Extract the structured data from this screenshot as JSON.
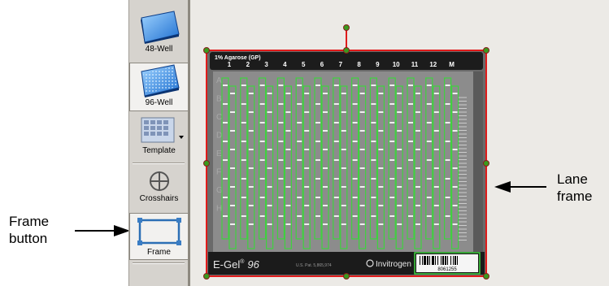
{
  "toolbar": {
    "buttons": [
      {
        "label": "48-Well",
        "icon": "plate-48-icon"
      },
      {
        "label": "96-Well",
        "icon": "plate-96-icon",
        "selected": true
      },
      {
        "label": "Template",
        "icon": "template-icon"
      },
      {
        "label": "Crosshairs",
        "icon": "crosshairs-icon"
      },
      {
        "label": "Frame",
        "icon": "frame-icon",
        "selected": true
      }
    ]
  },
  "gel": {
    "header_label": "1% Agarose (GP)",
    "lane_numbers": [
      "1",
      "2",
      "3",
      "4",
      "5",
      "6",
      "7",
      "8",
      "9",
      "10",
      "11",
      "12",
      "M"
    ],
    "row_letters": [
      "A",
      "B",
      "C",
      "D",
      "E",
      "F",
      "G",
      "H"
    ],
    "brand": "E-Gel",
    "brand_suffix": "96",
    "patent": "U.S. Pat. 5,865,974",
    "maker": "Invitrogen",
    "barcode_text": "8061255"
  },
  "annotations": {
    "frame_button": "Frame\nbutton",
    "lane_frame": "Lane\nframe"
  },
  "colors": {
    "frame_outline": "#e01b1b",
    "handle": "#3a9a1e",
    "lane_box": "#3fd13f",
    "toolbar_bg": "#d6d3ce"
  }
}
